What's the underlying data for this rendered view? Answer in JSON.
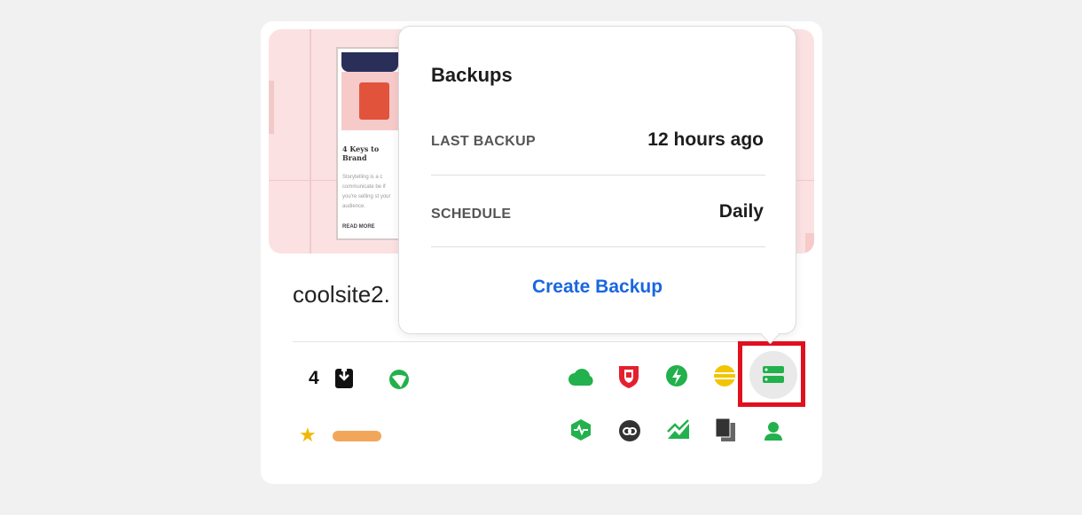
{
  "site": {
    "name": "coolsite2.",
    "thumbnail": {
      "heading": "4 Keys to Brand Storytelling",
      "body": "Storytelling is a c communicate be if you're selling st your audience.",
      "read_more": "READ MORE"
    },
    "count": "4"
  },
  "popover": {
    "title": "Backups",
    "rows": [
      {
        "label": "LAST BACKUP",
        "value": "12 hours ago"
      },
      {
        "label": "SCHEDULE",
        "value": "Daily"
      }
    ],
    "action": "Create Backup"
  },
  "colors": {
    "accent_green": "#22b14c",
    "link_blue": "#1a66e0",
    "highlight_red": "#e0101f",
    "star_yellow": "#f2b705",
    "tag_orange": "#f2a65a"
  },
  "icons": {
    "top_row": [
      "cloud-icon",
      "shield-icon",
      "bolt-icon",
      "plugin-icon",
      "backup-server-icon"
    ],
    "bottom_row": [
      "activity-icon",
      "link-icon",
      "chart-icon",
      "pages-icon",
      "user-icon"
    ],
    "left": [
      "download-icon",
      "wordpress-icon",
      "star-icon"
    ]
  }
}
